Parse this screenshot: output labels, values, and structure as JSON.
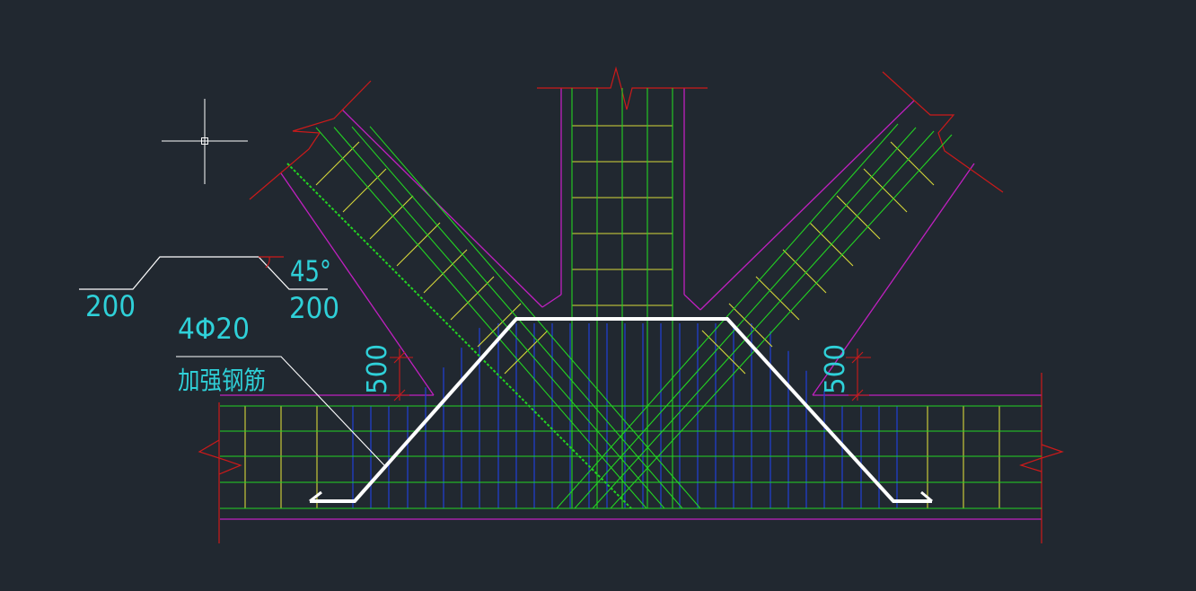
{
  "drawing": {
    "background": "#212830",
    "colors": {
      "outline": "#c020c0",
      "break_line": "#cc1a1a",
      "longitudinal_bar": "#23d423",
      "stirrup": "#d8d83a",
      "vertical_bar": "#1f3fd8",
      "reinforcement_bar": "#ffffff",
      "annotation": "#2fd0d8",
      "leader": "#ffffff"
    },
    "icons": {
      "cursor": "crosshair-cursor-icon"
    }
  },
  "bar_shape": {
    "left_length": "200",
    "right_length": "200",
    "angle": "45°"
  },
  "callout": {
    "bar_spec": "4Φ20",
    "description": "加强钢筋"
  },
  "dimensions": {
    "left_height": "500",
    "right_height": "500"
  }
}
